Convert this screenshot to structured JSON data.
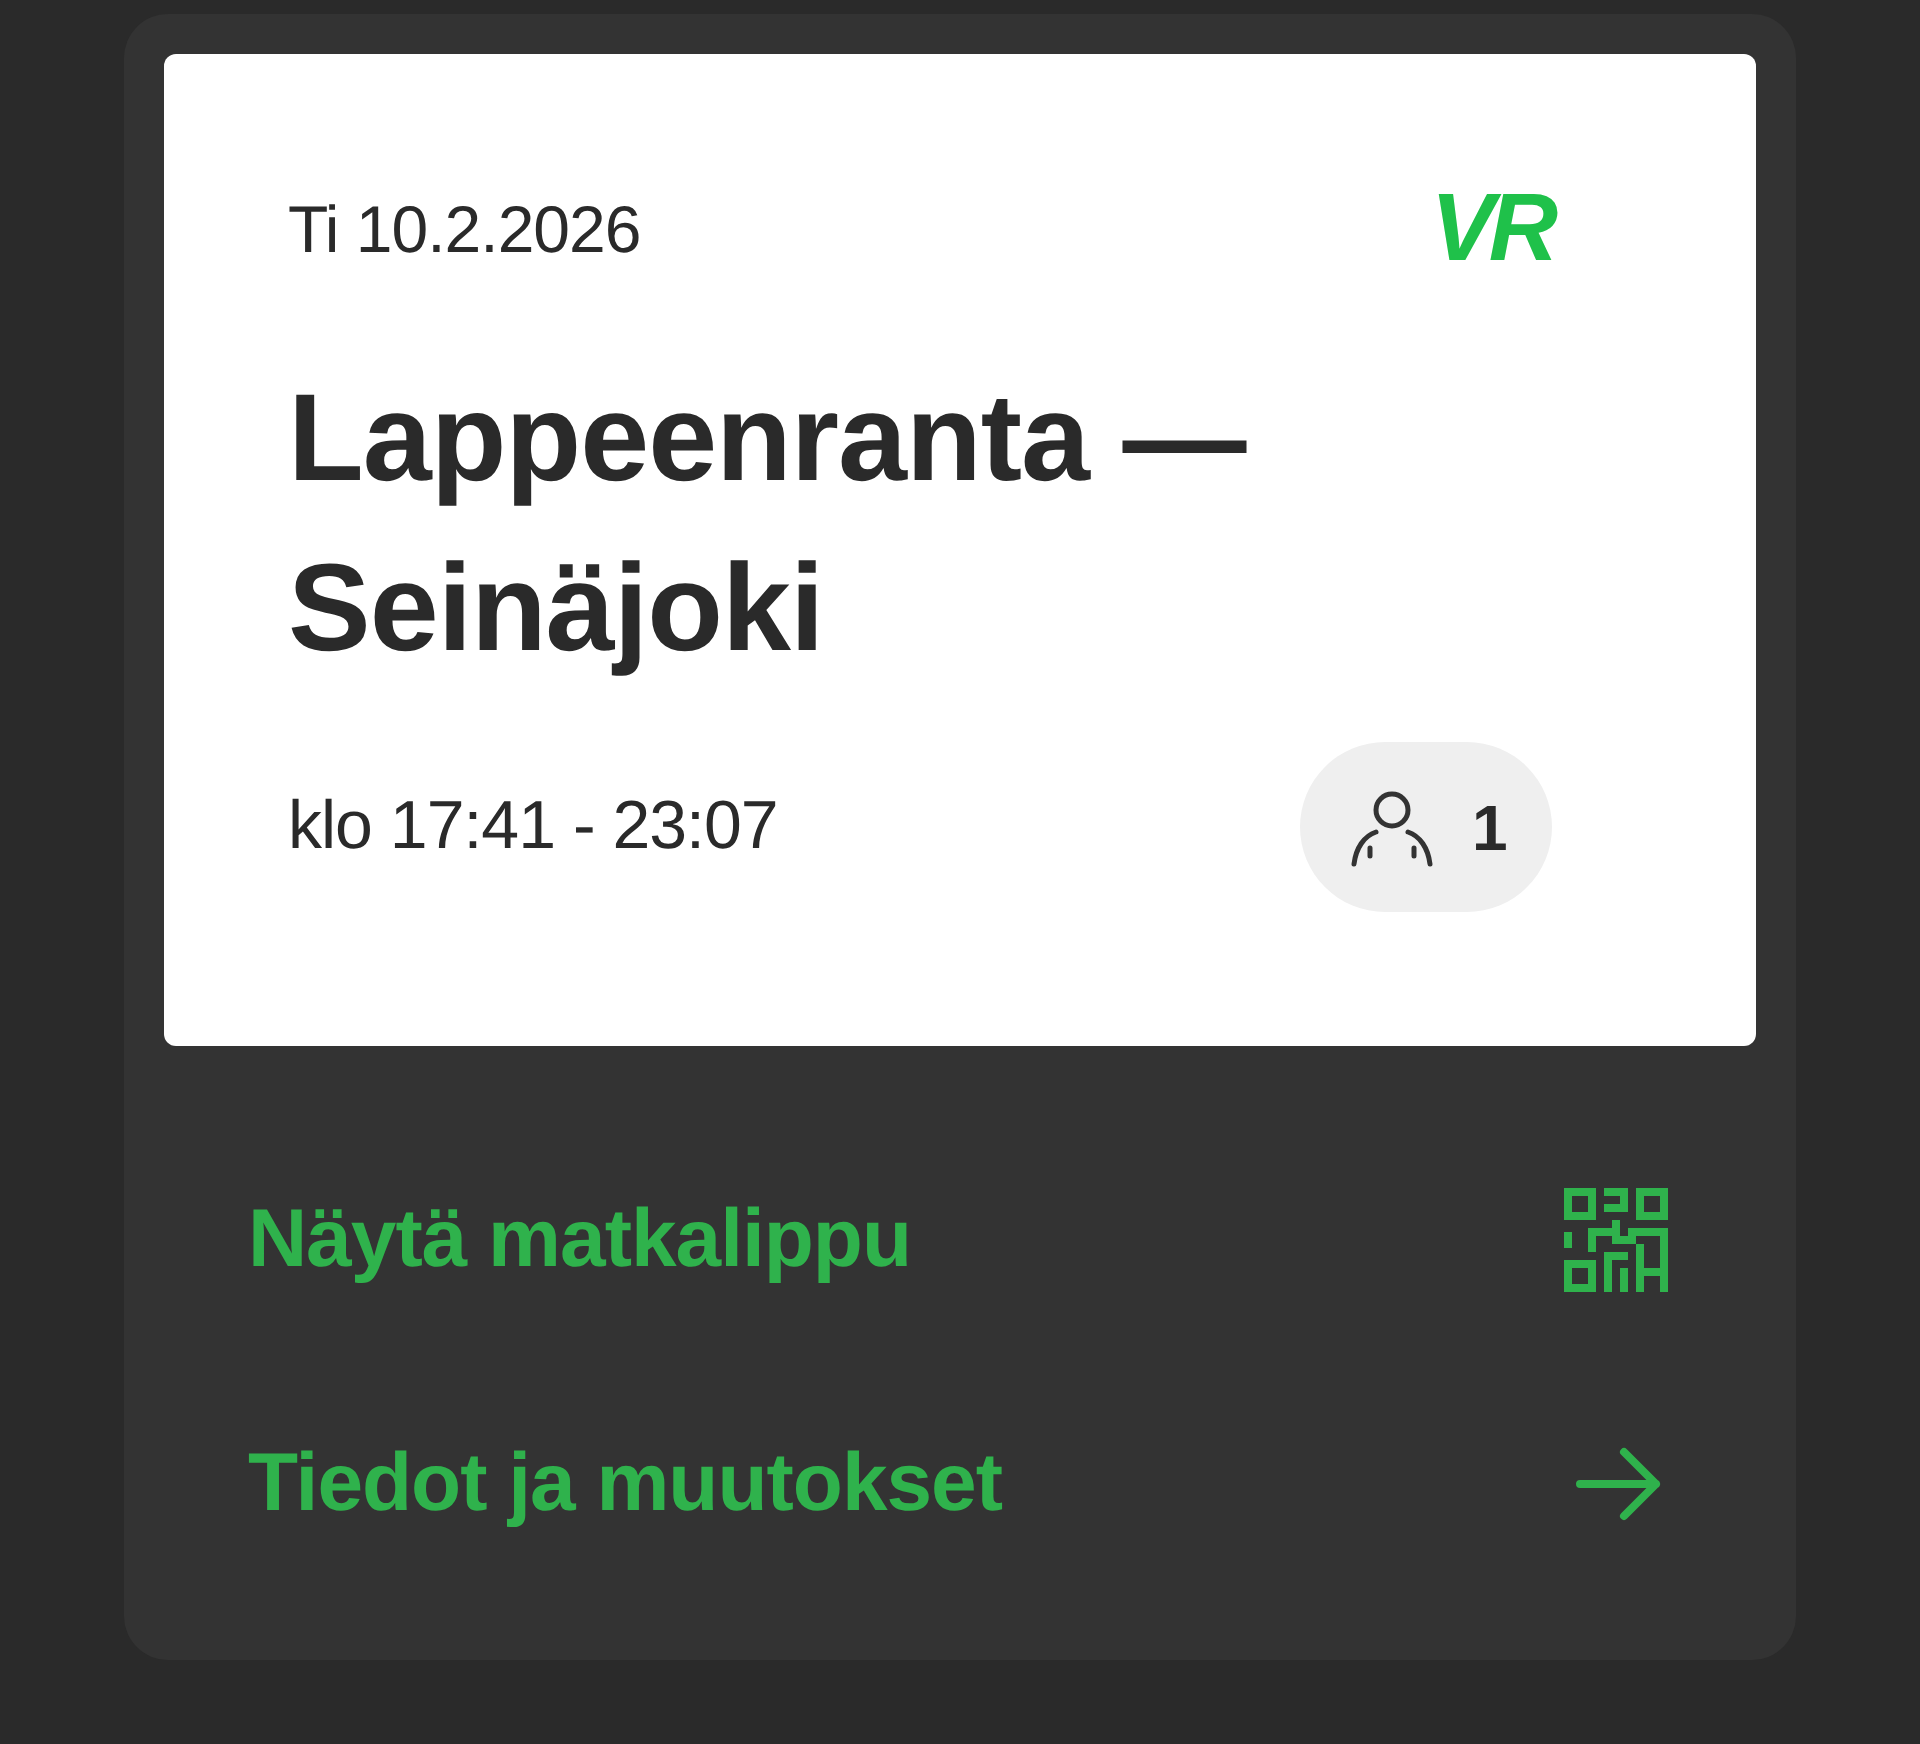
{
  "ticket": {
    "date": "Ti 10.2.2026",
    "logo": "VR",
    "route": "Lappeenranta — Seinäjoki",
    "time": "klo 17:41 - 23:07",
    "passengers": "1"
  },
  "actions": [
    {
      "label": "Näytä matkalippu",
      "kind": "qr"
    },
    {
      "label": "Tiedot ja muutokset",
      "kind": "arrow"
    }
  ]
}
